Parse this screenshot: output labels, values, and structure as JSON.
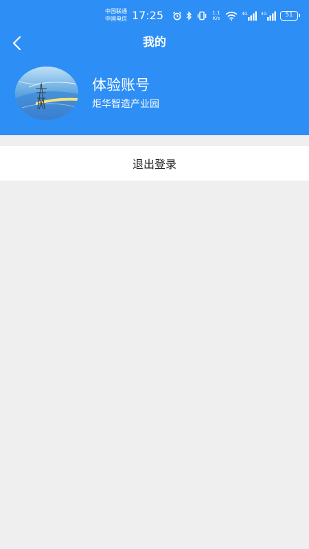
{
  "status_bar": {
    "carrier_1": "中国联通",
    "carrier_2": "中国电信",
    "time": "17:25",
    "net_speed_value": "1.1",
    "net_speed_unit": "K/s",
    "signal_1_tech": "4G",
    "signal_2_tech": "4G",
    "battery": "51",
    "icons": [
      "alarm-icon",
      "bluetooth-icon",
      "vibrate-icon",
      "wifi-icon",
      "signal-icon",
      "signal-icon",
      "battery-icon"
    ]
  },
  "nav": {
    "title": "我的",
    "back_icon": "back-arrow-icon"
  },
  "profile": {
    "account_name": "体验账号",
    "organization": "炬华智造产业园"
  },
  "menu": {
    "logout_label": "退出登录"
  },
  "colors": {
    "header_bg": "#2d8ef5",
    "page_bg": "#efefef",
    "item_bg": "#ffffff"
  }
}
